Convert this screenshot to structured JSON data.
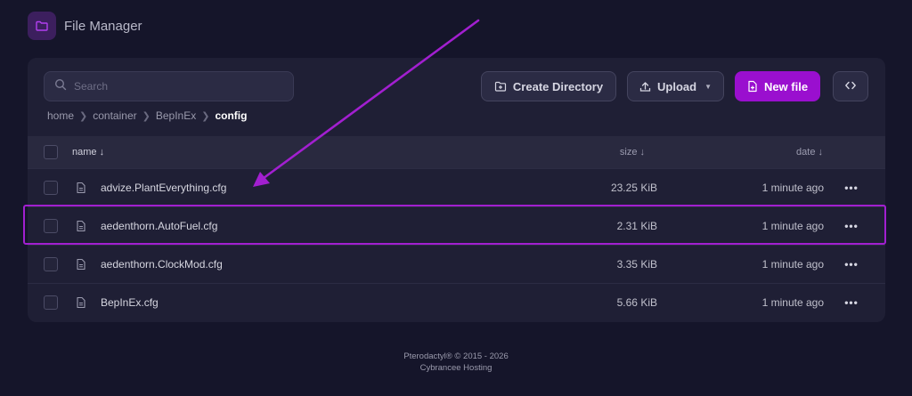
{
  "app": {
    "title": "File Manager"
  },
  "search": {
    "placeholder": "Search"
  },
  "breadcrumb": [
    "home",
    "container",
    "BepInEx",
    "config"
  ],
  "actions": {
    "create_directory": "Create Directory",
    "upload": "Upload",
    "new_file": "New file"
  },
  "table": {
    "headers": {
      "name": "name ↓",
      "size": "size ↓",
      "date": "date ↓"
    },
    "rows": [
      {
        "name": "advize.PlantEverything.cfg",
        "size": "23.25 KiB",
        "date": "1 minute ago",
        "highlighted": false
      },
      {
        "name": "aedenthorn.AutoFuel.cfg",
        "size": "2.31 KiB",
        "date": "1 minute ago",
        "highlighted": true
      },
      {
        "name": "aedenthorn.ClockMod.cfg",
        "size": "3.35 KiB",
        "date": "1 minute ago",
        "highlighted": false
      },
      {
        "name": "BepInEx.cfg",
        "size": "5.66 KiB",
        "date": "1 minute ago",
        "highlighted": false
      }
    ],
    "row_menu": "•••"
  },
  "footer": {
    "line1": "Pterodactyl® © 2015 - 2026",
    "line2": "Cybrancee Hosting"
  },
  "colors": {
    "background": "#15152a",
    "panel": "#1f1f35",
    "accent": "#9a0fcf",
    "annotation": "#a21fd0"
  }
}
